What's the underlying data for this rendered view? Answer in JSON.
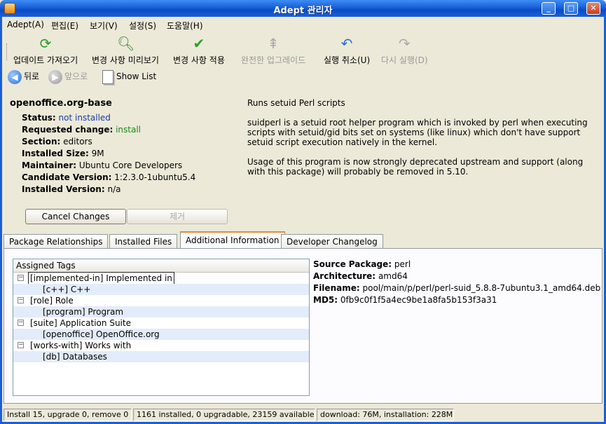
{
  "window": {
    "title": "Adept 관리자"
  },
  "menu": [
    "Adept(A)",
    "편집(E)",
    "보기(V)",
    "설정(S)",
    "도움말(H)"
  ],
  "toolbar": {
    "fetch": "업데이트 가져오기",
    "preview": "변경 사항 미리보기",
    "apply": "변경 사항 적용",
    "full_upgrade": "완전한 업그레이드",
    "undo": "실행 취소(U)",
    "redo": "다시 실행(D)"
  },
  "nav": {
    "back": "뒤로",
    "forward": "앞으로",
    "show_list": "Show List"
  },
  "package": {
    "name": "openoffice.org-base",
    "status_label": "Status:",
    "status": "not installed",
    "requested_label": "Requested change:",
    "requested": "install",
    "section_label": "Section:",
    "section": "editors",
    "size_label": "Installed Size:",
    "size": "9M",
    "maintainer_label": "Maintainer:",
    "maintainer": "Ubuntu Core Developers",
    "candidate_label": "Candidate Version:",
    "candidate": "1:2.3.0-1ubuntu5.4",
    "installed_label": "Installed Version:",
    "installed": "n/a"
  },
  "description": {
    "summary": "Runs setuid Perl scripts",
    "p1": "suidperl is a setuid root helper program which is invoked by perl when executing scripts with setuid/gid bits set on systems (like linux) which don't have support setuid script execution natively in the kernel.",
    "p2": "Usage of this program is now strongly deprecated upstream and support (along with this package) will probably be removed in 5.10."
  },
  "buttons": {
    "cancel": "Cancel Changes",
    "remove": "제거"
  },
  "tabs": [
    "Package Relationships",
    "Installed Files",
    "Additional Information",
    "Developer Changelog"
  ],
  "tags": {
    "header": "Assigned Tags",
    "rows": [
      {
        "text": "[implemented-in] Implemented in",
        "level": 0
      },
      {
        "text": "[c++] C++",
        "level": 1
      },
      {
        "text": "[role] Role",
        "level": 0
      },
      {
        "text": "[program] Program",
        "level": 1
      },
      {
        "text": "[suite] Application Suite",
        "level": 0
      },
      {
        "text": "[openoffice] OpenOffice.org",
        "level": 1
      },
      {
        "text": "[works-with] Works with",
        "level": 0
      },
      {
        "text": "[db] Databases",
        "level": 1
      }
    ]
  },
  "info": {
    "source_label": "Source Package:",
    "source": "perl",
    "arch_label": "Architecture:",
    "arch": "amd64",
    "file_label": "Filename:",
    "file": "pool/main/p/perl/perl-suid_5.8.8-7ubuntu3.1_amd64.deb",
    "md5_label": "MD5:",
    "md5": "0fb9c0f1f5a4ec9be1a8fa5b153f3a31"
  },
  "status": {
    "changes": "Install 15, upgrade 0, remove 0",
    "counts": "1161 installed, 0 upgradable, 23159 available",
    "download": "download: 76M, installation: 228M"
  }
}
